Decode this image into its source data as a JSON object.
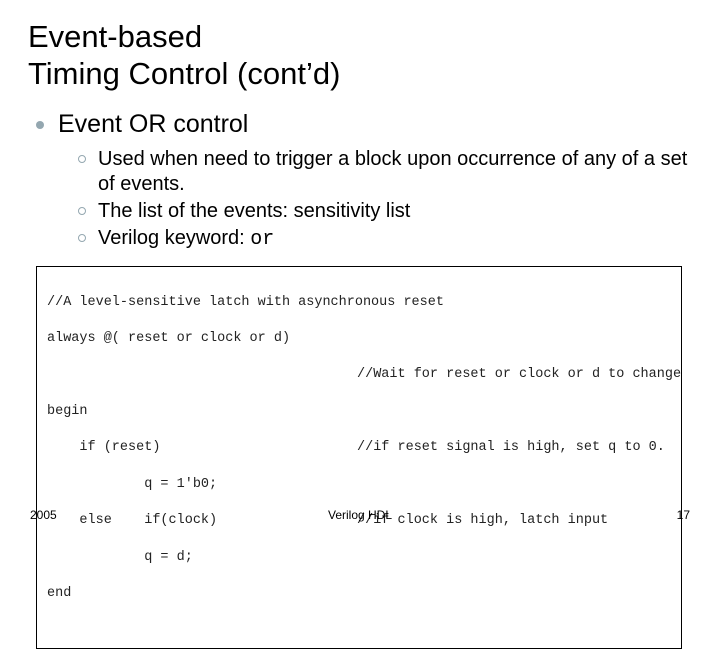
{
  "title_line1": "Event-based",
  "title_line2": "Timing Control (cont’d)",
  "l1_text": "Event OR control",
  "bullets": [
    "Used when need to trigger a block upon occurrence of any of a set of events.",
    "The list of the events: sensitivity list",
    "Verilog keyword: "
  ],
  "verilog_keyword": "or",
  "code": {
    "c1": "//A level-sensitive latch with asynchronous reset",
    "c2": "always @( reset or clock or d)",
    "c3_l": "",
    "c3_r": "//Wait for reset or clock or d to change",
    "c4": "begin",
    "c5_l": "    if (reset)",
    "c5_r": "//if reset signal is high, set q to 0.",
    "c6": "            q = 1'b0;",
    "c7_l": "    else    if(clock)",
    "c7_r": "//if clock is high, latch input",
    "c8": "            q = d;",
    "c9": "end"
  },
  "footer": {
    "left": "2005",
    "center": "Verilog HDL",
    "right": "17"
  }
}
